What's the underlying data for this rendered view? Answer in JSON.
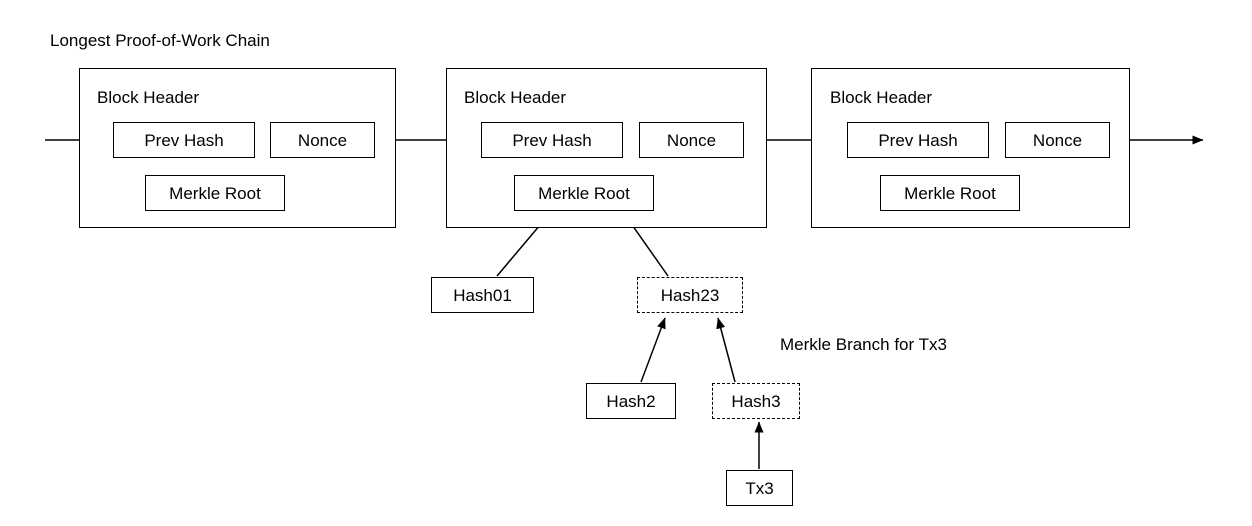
{
  "diagram": {
    "title": "Longest Proof-of-Work Chain",
    "branch_label": "Merkle Branch for Tx3",
    "blocks": [
      {
        "header_label": "Block Header",
        "prev_hash_label": "Prev Hash",
        "nonce_label": "Nonce",
        "merkle_root_label": "Merkle Root"
      },
      {
        "header_label": "Block Header",
        "prev_hash_label": "Prev Hash",
        "nonce_label": "Nonce",
        "merkle_root_label": "Merkle Root"
      },
      {
        "header_label": "Block Header",
        "prev_hash_label": "Prev Hash",
        "nonce_label": "Nonce",
        "merkle_root_label": "Merkle Root"
      }
    ],
    "merkle_nodes": {
      "hash01": "Hash01",
      "hash23": "Hash23",
      "hash2": "Hash2",
      "hash3": "Hash3",
      "tx3": "Tx3"
    },
    "colors": {
      "stroke": "#000000",
      "background": "#ffffff",
      "text": "#000000"
    }
  }
}
